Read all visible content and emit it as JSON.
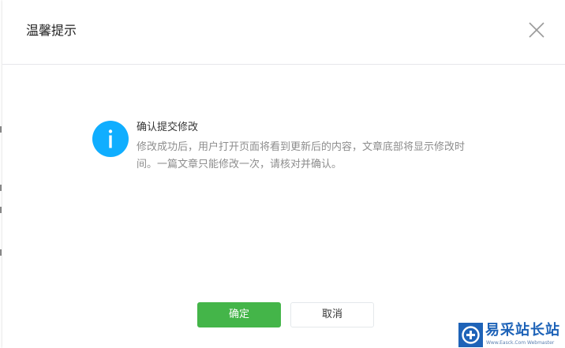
{
  "dialog": {
    "title": "温馨提示",
    "close_icon": "close-icon",
    "message": {
      "icon": "info-icon",
      "icon_color": "#10aeff",
      "title": "确认提交修改",
      "description": "修改成功后，用户打开页面将看到更新后的内容，文章底部将显示修改时间。一篇文章只能修改一次，请核对并确认。"
    },
    "buttons": {
      "confirm_label": "确定",
      "cancel_label": "取消",
      "confirm_color": "#44b549"
    }
  },
  "watermark": {
    "title": "易采站长站",
    "subtitle": "Www.Easck.Com  Webmaster",
    "color": "#1e63b8"
  }
}
